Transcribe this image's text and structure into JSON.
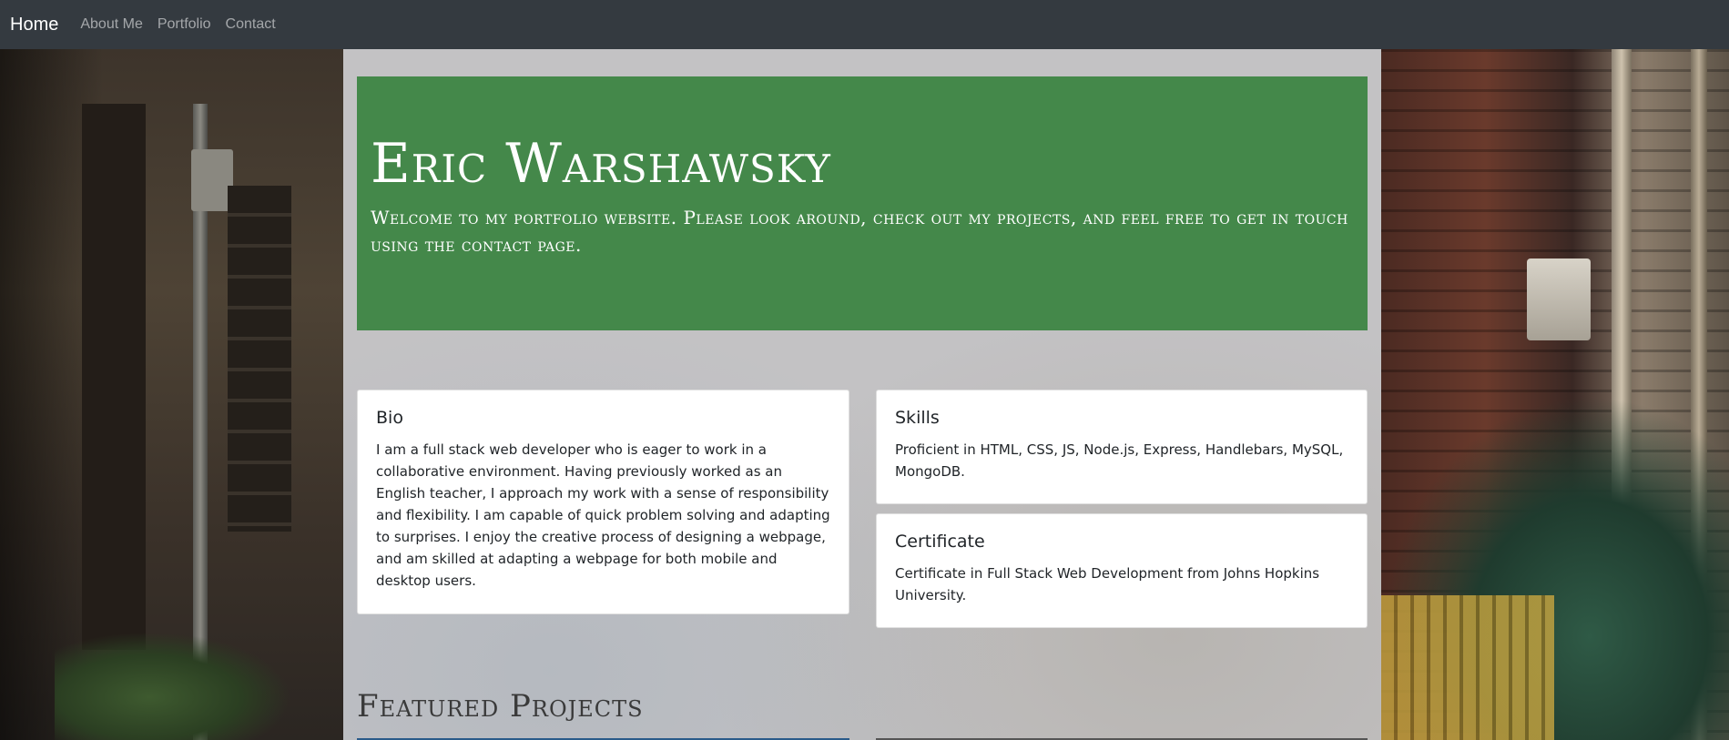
{
  "navbar": {
    "brand": "Home",
    "links": [
      "About Me",
      "Portfolio",
      "Contact"
    ],
    "background": "#343a40"
  },
  "jumbotron": {
    "title": "Eric Warshawsky",
    "lead": "Welcome to my portfolio website. Please look around, check out my projects, and feel free to get in touch using the contact page.",
    "background": "#44884a"
  },
  "cards": {
    "bio": {
      "title": "Bio",
      "text": "I am a full stack web developer who is eager to work in a collaborative environment. Having previously worked as an English teacher, I approach my work with a sense of responsibility and flexibility. I am capable of quick problem solving and adapting to surprises. I enjoy the creative process of designing a webpage, and am skilled at adapting a webpage for both mobile and desktop users."
    },
    "skills": {
      "title": "Skills",
      "text": "Proficient in HTML, CSS, JS, Node.js, Express, Handlebars, MySQL, MongoDB."
    },
    "certificate": {
      "title": "Certificate",
      "text": "Certificate in Full Stack Web Development from Johns Hopkins University."
    }
  },
  "featured_heading": "Featured Projects"
}
